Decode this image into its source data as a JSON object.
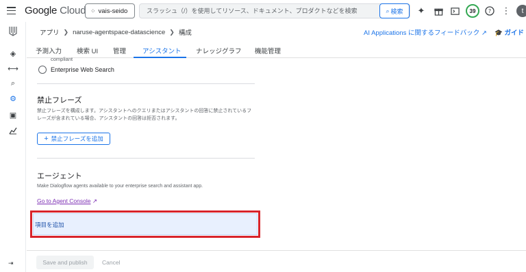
{
  "topbar": {
    "logo_google": "Google",
    "logo_cloud": "Cloud",
    "project": "vais-seido",
    "search_placeholder": "スラッシュ（/）を使用してリソース、ドキュメント、プロダクトなどを検索",
    "search_button": "検索",
    "notification_count": "39",
    "avatar_letter": "t"
  },
  "breadcrumb": {
    "items": [
      "アプリ",
      "naruse-agentspace-datascience",
      "構成"
    ]
  },
  "header_links": {
    "feedback": "AI Applications に関するフィードバック",
    "guide": "ガイド"
  },
  "tabs": [
    "予測入力",
    "検索 UI",
    "管理",
    "アシスタント",
    "ナレッジグラフ",
    "機能管理"
  ],
  "content": {
    "compliant": "compliant",
    "web_search_option": "Enterprise Web Search",
    "banned_phrases": {
      "title": "禁止フレーズ",
      "description": "禁止フレーズを構成します。アシスタントへのクエリまたはアシスタントの回答に禁止されているフレーズが含まれている場合、アシスタントの回答は拒否されます。",
      "add_button": "禁止フレーズを追加"
    },
    "agents": {
      "title": "エージェント",
      "description": "Make Dialogflow agents available to your enterprise search and assistant app.",
      "console_link": "Go to Agent Console",
      "add_item": "項目を追加"
    }
  },
  "footer": {
    "save": "Save and publish",
    "cancel": "Cancel"
  },
  "colors": {
    "accent": "#1a73e8",
    "highlight_box": "#d8232a"
  }
}
